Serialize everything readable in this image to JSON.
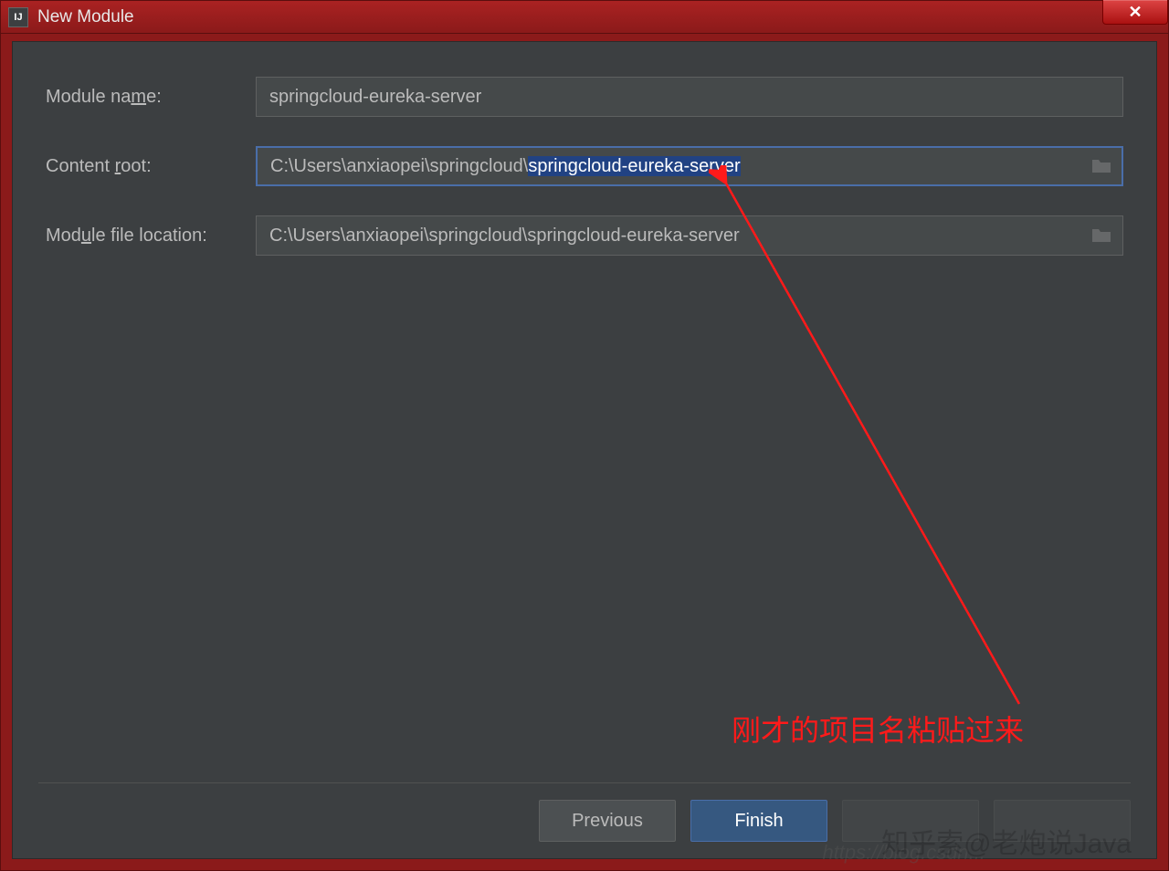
{
  "titlebar": {
    "icon_text": "IJ",
    "title": "New Module"
  },
  "form": {
    "module_name": {
      "label_pre": "Module na",
      "label_u": "m",
      "label_post": "e:",
      "value": "springcloud-eureka-server"
    },
    "content_root": {
      "label_pre": "Content ",
      "label_u": "r",
      "label_post": "oot:",
      "prefix": "C:\\Users\\anxiaopei\\springcloud\\",
      "selected": "springcloud-eureka-server"
    },
    "module_file": {
      "label_pre": "Mod",
      "label_u": "u",
      "label_post": "le file location:",
      "value": "C:\\Users\\anxiaopei\\springcloud\\springcloud-eureka-server"
    }
  },
  "buttons": {
    "previous": "Previous",
    "finish": "Finish"
  },
  "annotation": "刚才的项目名粘贴过来",
  "watermark": "知乎索@老炮说Java",
  "watermark2": "https://blog.csdn..."
}
